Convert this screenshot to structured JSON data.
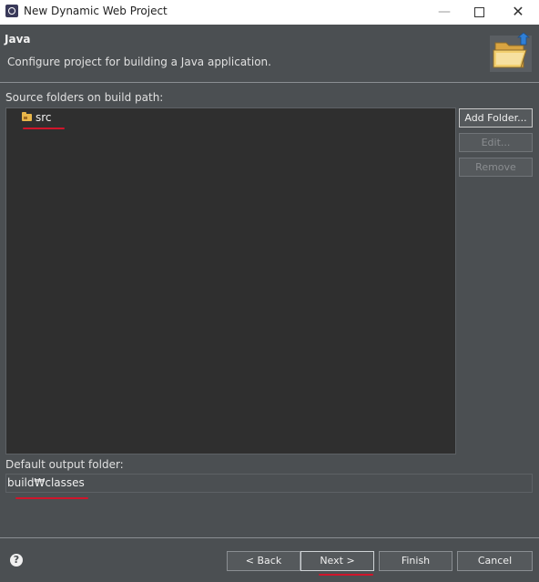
{
  "window": {
    "title": "New Dynamic Web Project",
    "controls": {
      "minimize": "—",
      "close": "✕"
    }
  },
  "header": {
    "title": "Java",
    "description": "Configure project for building a Java application.",
    "banner_icon": "folder-banner-icon"
  },
  "source": {
    "label": "Source folders on build path:",
    "items": [
      {
        "label": "src",
        "icon": "source-folder-icon"
      }
    ]
  },
  "side_buttons": {
    "add_folder": "Add Folder...",
    "edit": "Edit...",
    "remove": "Remove"
  },
  "output": {
    "label": "Default output folder:",
    "value": "build₩classes"
  },
  "footer": {
    "help": "?",
    "back": "< Back",
    "next": "Next >",
    "finish": "Finish",
    "cancel": "Cancel"
  },
  "colors": {
    "background": "#4b4f52",
    "tree_background": "#2f2f2f",
    "annotation_red": "#d0152b"
  }
}
